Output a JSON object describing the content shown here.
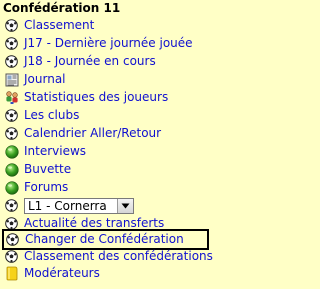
{
  "panel": {
    "title": "Confédération 11"
  },
  "menu": {
    "items": [
      {
        "label": "Classement",
        "icon": "soccer-ball-icon"
      },
      {
        "label": "J17 - Dernière journée jouée",
        "icon": "soccer-ball-icon"
      },
      {
        "label": "J18 - Journée en cours",
        "icon": "soccer-ball-icon"
      },
      {
        "label": "Journal",
        "icon": "newspaper-icon"
      },
      {
        "label": "Statistiques des joueurs",
        "icon": "players-icon"
      },
      {
        "label": "Les clubs",
        "icon": "soccer-ball-icon"
      },
      {
        "label": "Calendrier Aller/Retour",
        "icon": "soccer-ball-icon"
      },
      {
        "label": "Interviews",
        "icon": "green-globe-icon"
      },
      {
        "label": "Buvette",
        "icon": "green-globe-icon"
      },
      {
        "label": "Forums",
        "icon": "green-globe-icon"
      },
      {
        "label": "Actualité des transferts",
        "icon": "soccer-ball-icon"
      },
      {
        "label": "Changer de Confédération",
        "icon": "soccer-ball-icon"
      },
      {
        "label": "Classement des confédérations",
        "icon": "soccer-ball-icon"
      },
      {
        "label": "Modérateurs",
        "icon": "folder-icon"
      }
    ]
  },
  "league_select": {
    "value": "L1 - Cornerra",
    "icon": "soccer-ball-icon"
  },
  "colors": {
    "background": "#ffffc6",
    "link": "#1010d0",
    "selected_border": "#000000"
  }
}
